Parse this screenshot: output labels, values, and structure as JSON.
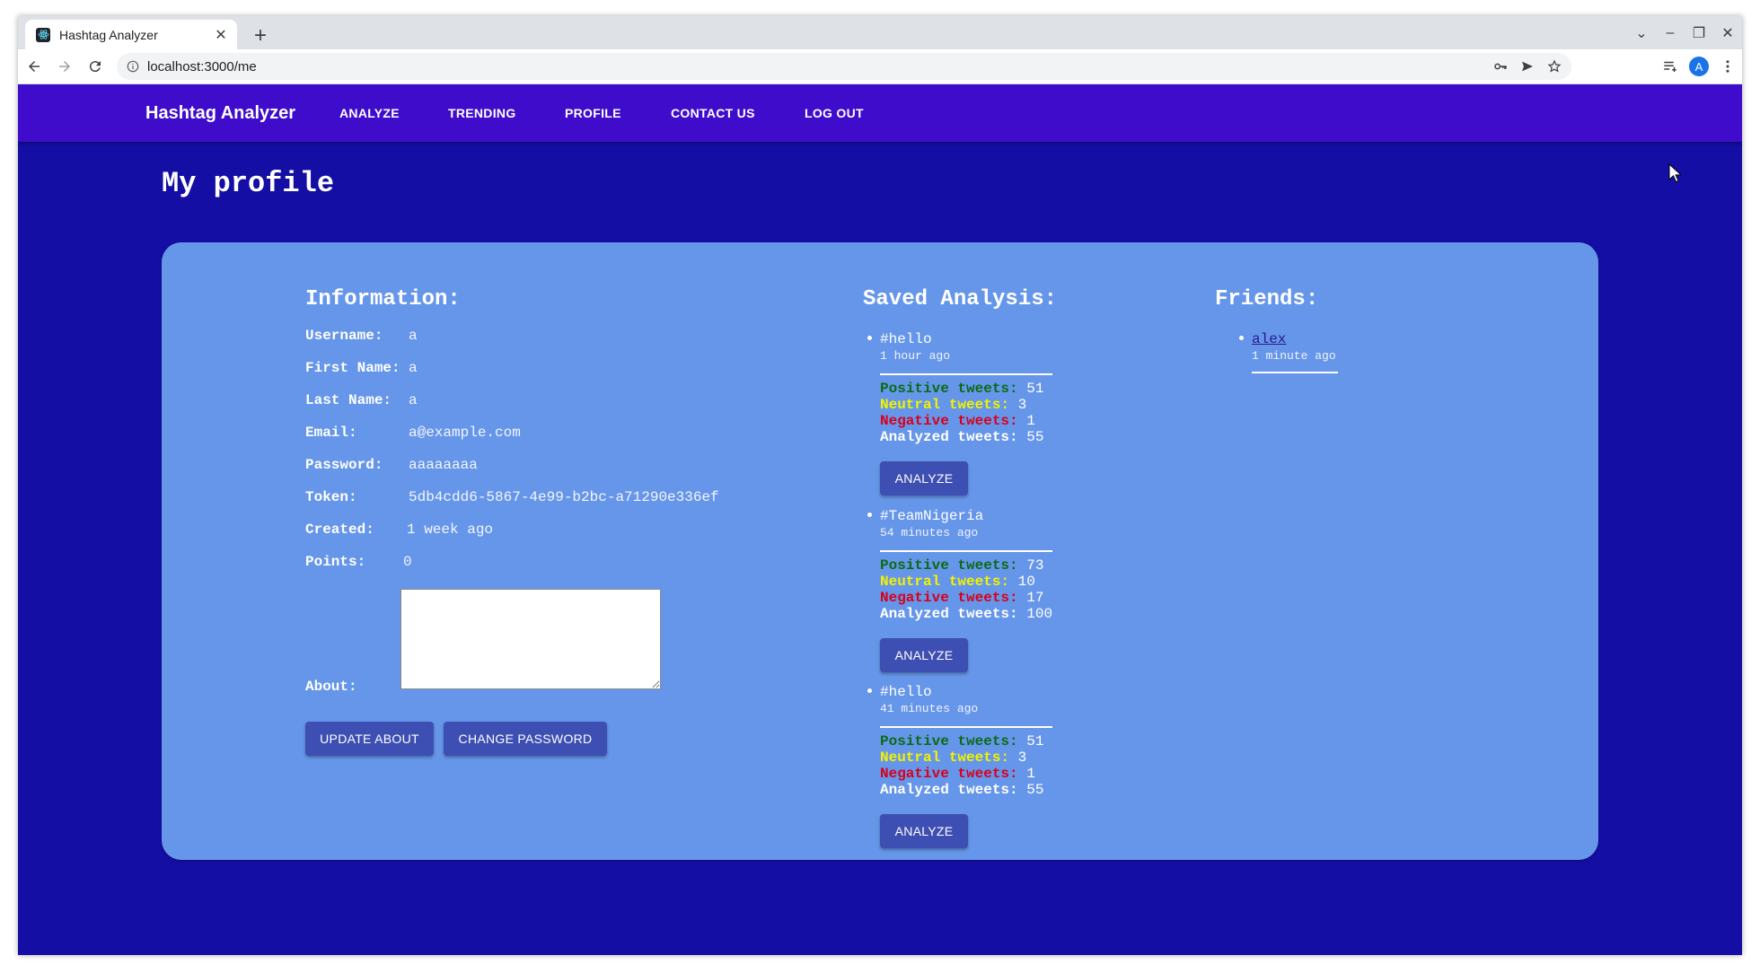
{
  "browser": {
    "tab_title": "Hashtag Analyzer",
    "url": "localhost:3000/me",
    "profile_initial": "A"
  },
  "appbar": {
    "brand": "Hashtag Analyzer",
    "nav": [
      "ANALYZE",
      "TRENDING",
      "PROFILE",
      "CONTACT US",
      "LOG OUT"
    ]
  },
  "page_title": "My profile",
  "information": {
    "heading": "Information:",
    "username_label": "Username:",
    "username": "a",
    "first_name_label": "First Name:",
    "first_name": "a",
    "last_name_label": "Last Name:",
    "last_name": "a",
    "email_label": "Email:",
    "email": "a@example.com",
    "password_label": "Password:",
    "password": "aaaaaaaa",
    "token_label": "Token:",
    "token": "5db4cdd6-5867-4e99-b2bc-a71290e336ef",
    "created_label": "Created:",
    "created": "1 week ago",
    "points_label": "Points:",
    "points": "0",
    "about_label": "About:",
    "about_value": "",
    "update_about_button": "UPDATE ABOUT",
    "change_password_button": "CHANGE PASSWORD"
  },
  "saved_analysis": {
    "heading": "Saved Analysis:",
    "positive_label": "Positive tweets:",
    "neutral_label": "Neutral tweets:",
    "negative_label": "Negative tweets:",
    "analyzed_label": "Analyzed tweets:",
    "analyze_button": "ANALYZE",
    "items": [
      {
        "hashtag": "#hello",
        "time": "1 hour ago",
        "positive": "51",
        "neutral": "3",
        "negative": "1",
        "analyzed": "55"
      },
      {
        "hashtag": "#TeamNigeria",
        "time": "54 minutes ago",
        "positive": "73",
        "neutral": "10",
        "negative": "17",
        "analyzed": "100"
      },
      {
        "hashtag": "#hello",
        "time": "41 minutes ago",
        "positive": "51",
        "neutral": "3",
        "negative": "1",
        "analyzed": "55"
      }
    ]
  },
  "friends": {
    "heading": "Friends:",
    "items": [
      {
        "name": "alex",
        "time": "1 minute ago"
      }
    ]
  },
  "colors": {
    "page_background": "#140ea4",
    "appbar": "#3f0ccc",
    "card": "#6696e9",
    "button": "#3d4fb2",
    "positive": "#0b6b17",
    "neutral": "#f2f200",
    "negative": "#d8001c"
  }
}
